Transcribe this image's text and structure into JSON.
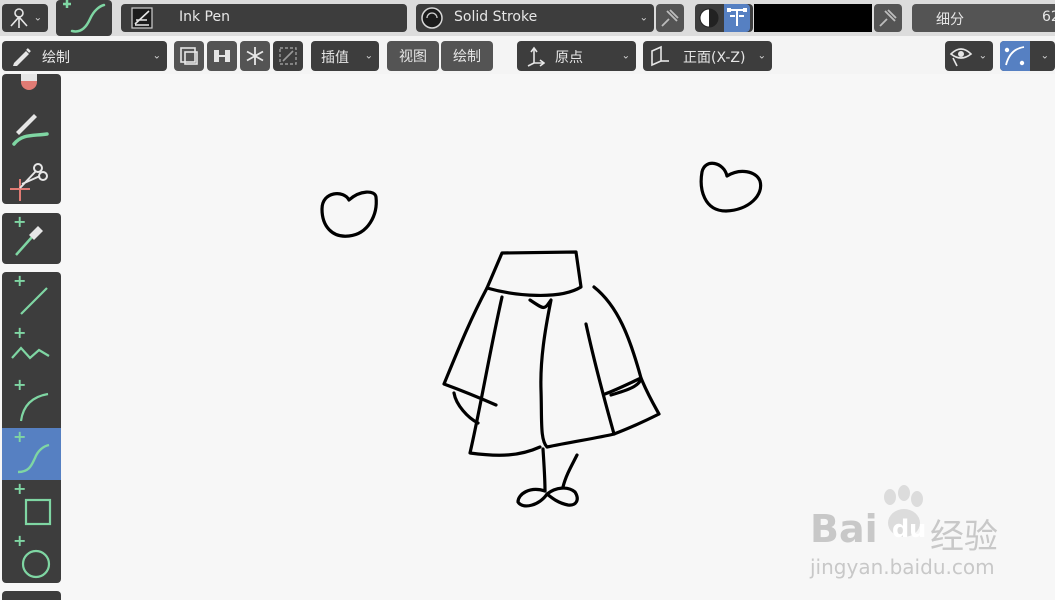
{
  "header": {
    "brush_name": "Ink Pen",
    "material_name": "Solid Stroke",
    "subdivide_label": "细分",
    "subdivide_value": "62"
  },
  "toolbar": {
    "mode_label": "绘制",
    "interpolate_label": "插值",
    "view_label": "视图",
    "draw_label": "绘制",
    "origin_label": "原点",
    "plane_label": "正面(X-Z)"
  },
  "colors": {
    "active_tool": "#5680c2",
    "accent_green": "#7fd6a3",
    "panel_dark": "#3d3d3d"
  },
  "left_tools": [
    "erase-tool",
    "tint-tool",
    "cutter-tool",
    "eyedropper-tool",
    "line-tool",
    "polyline-tool",
    "arc-tool",
    "curve-tool",
    "box-tool",
    "circle-tool"
  ],
  "watermark": {
    "brand_latin": "Bai",
    "brand_du": "du",
    "brand_cn": "经验",
    "url": "jingyan.baidu.com"
  }
}
